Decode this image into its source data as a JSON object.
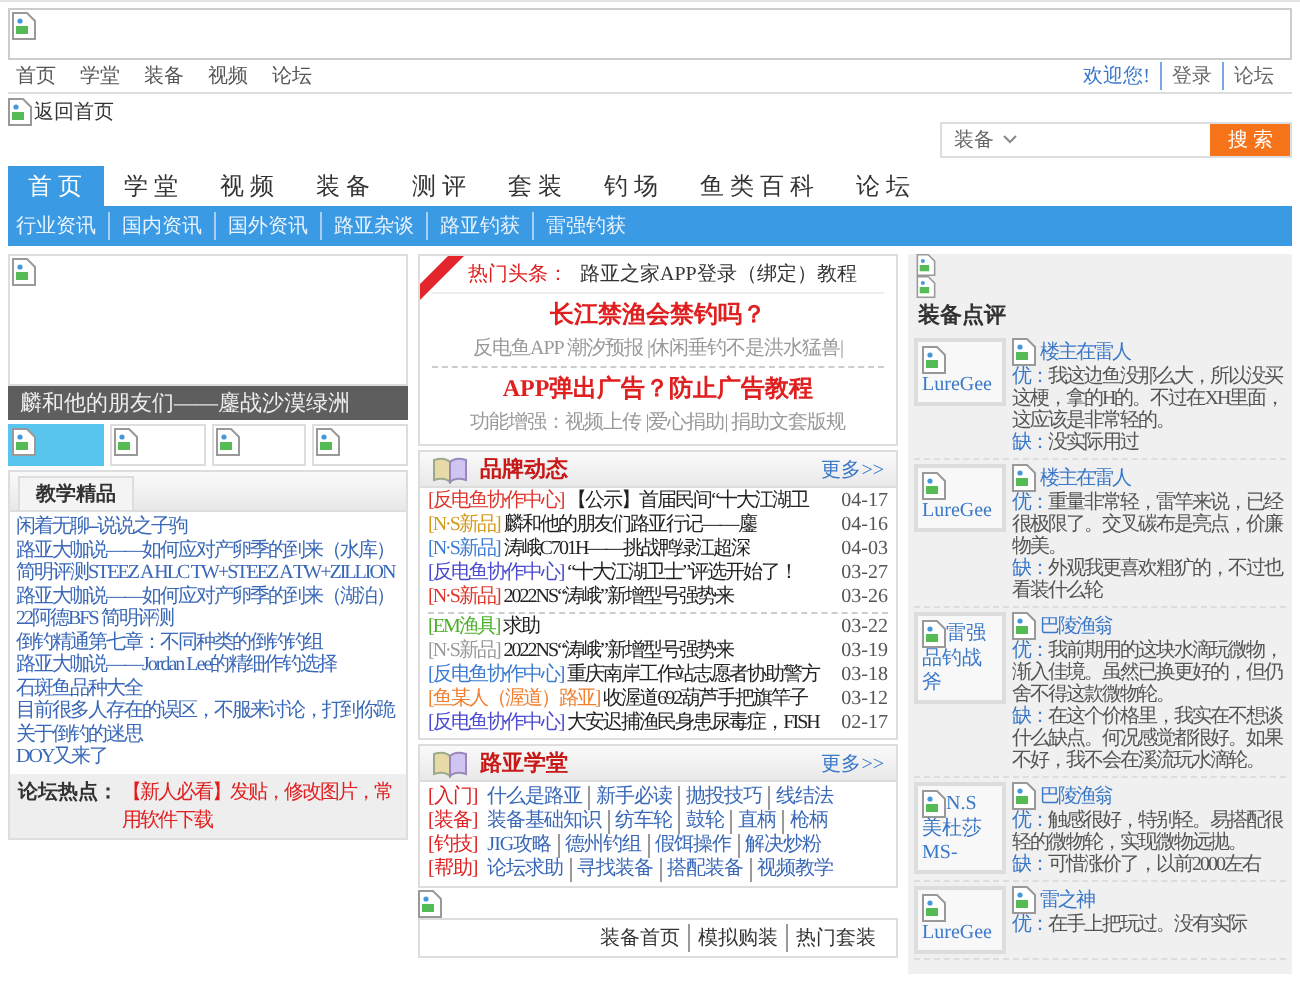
{
  "top_links": [
    "首页",
    "学堂",
    "装备",
    "视频",
    "论坛"
  ],
  "user_links": [
    {
      "label": "欢迎您!",
      "kind": "greeting"
    },
    {
      "label": "登录",
      "kind": "link"
    },
    {
      "label": "论坛",
      "kind": "link"
    }
  ],
  "home_logo_alt": "返回首页",
  "search": {
    "category": "装备",
    "button": "搜 索"
  },
  "nav": [
    {
      "label": "首页",
      "selected": true
    },
    {
      "label": "学堂",
      "selected": false
    },
    {
      "label": "视频",
      "selected": false
    },
    {
      "label": "装备",
      "selected": false
    },
    {
      "label": "测评",
      "selected": false
    },
    {
      "label": "套装",
      "selected": false
    },
    {
      "label": "钓场",
      "selected": false
    },
    {
      "label": "鱼类百科",
      "selected": false
    },
    {
      "label": "论坛",
      "selected": false
    }
  ],
  "subnav": [
    "行业资讯",
    "国内资讯",
    "国外资讯",
    "路亚杂谈",
    "路亚钓获",
    "雷强钓获"
  ],
  "slideshow": {
    "caption": "麟和他的朋友们——鏖战沙漠绿洲",
    "thumbnails": [
      {
        "selected": true
      },
      {
        "selected": false
      },
      {
        "selected": false
      },
      {
        "selected": false
      }
    ]
  },
  "tutorials": {
    "tab": "教学精品",
    "items": [
      "闲着无聊--说说之子驹",
      "路亚大咖说——如何应对产卵季的到来（水库）",
      "简明评测STEEZ A HLC TW+STEEZ A TW+ZILLION",
      "路亚大咖说——如何应对产卵季的到来（湖泊）",
      "22阿德BFS 简明评测",
      "倒钓精通第七章：不同种类的倒钓钓组",
      "路亚大咖说——Jordan Lee的精细作钓选择",
      "石斑鱼品种大全",
      "目前很多人存在的误区，不服来讨论，打到你跪",
      "关于倒钓的迷思",
      "DOY又来了"
    ]
  },
  "forum_hot": {
    "label": "论坛热点：",
    "text": "【新人必看】发贴，修改图片，常用软件下载"
  },
  "headlines": {
    "hot_label": "热门头条：",
    "hot_title": "路亚之家APP登录（绑定）教程",
    "stories": [
      {
        "title": "长江禁渔会禁钓吗？",
        "sub": "反电鱼APP 潮汐预报 |休闲垂钓不是洪水猛兽|"
      },
      {
        "title": "APP弹出广告？防止广告教程",
        "sub": "功能增强：视频上传 |爱心捐助| 捐助文套版规"
      }
    ]
  },
  "brand_news": {
    "title": "品牌动态",
    "more": "更多>>",
    "groups": [
      [
        {
          "tag": "[反电鱼协作中心]",
          "color": "#e0352b",
          "title": "【公示】首届民间“十大江湖卫",
          "date": "04-17"
        },
        {
          "tag": "[N·S新品]",
          "color": "#d49a1c",
          "title": "麟和他的朋友们路亚行记——鏖",
          "date": "04-16"
        },
        {
          "tag": "[N·S新品]",
          "color": "#3b7bd1",
          "title": "涛峨C701H——挑战鸭绿江超深",
          "date": "04-03"
        },
        {
          "tag": "[反电鱼协作中心]",
          "color": "#4a4ad0",
          "title": "“十大江湖卫士”评选开始了！",
          "date": "03-27"
        },
        {
          "tag": "[N·S新品]",
          "color": "#e0352b",
          "title": "2022NS“涛峨”新增型号强势来",
          "date": "03-26"
        }
      ],
      [
        {
          "tag": "[EM渔具]",
          "color": "#4caf2a",
          "title": "求助",
          "date": "03-22"
        },
        {
          "tag": "[N·S新品]",
          "color": "#999999",
          "title": "2022NS“涛峨”新增型号强势来",
          "date": "03-19"
        },
        {
          "tag": "[反电鱼协作中心]",
          "color": "#3b7bd1",
          "title": "重庆南岸工作站志愿者协助警方",
          "date": "03-18"
        },
        {
          "tag": "[鱼某人（渥道）路亚]",
          "color": "#f08030",
          "title": "收渥道692葫芦手把旗竿子",
          "date": "03-12"
        },
        {
          "tag": "[反电鱼协作中心]",
          "color": "#4a4ad0",
          "title": "大安迟捕渔民身患尿毒症，FISH",
          "date": "02-17"
        }
      ]
    ]
  },
  "lure_school": {
    "title": "路亚学堂",
    "more": "更多>>",
    "lines": [
      {
        "tag": "[入门]",
        "links": [
          "什么是路亚",
          "新手必读",
          "抛投技巧",
          "线结法"
        ]
      },
      {
        "tag": "[装备]",
        "links": [
          "装备基础知识",
          "纺车轮",
          "鼓轮",
          "直柄",
          "枪柄"
        ]
      },
      {
        "tag": "[钓技]",
        "links": [
          "JIG攻略",
          "德州钓组",
          "假饵操作",
          "解决炒粉"
        ]
      },
      {
        "tag": "[帮助]",
        "links": [
          "论坛求助",
          "寻找装备",
          "搭配装备",
          "视频教学"
        ]
      }
    ]
  },
  "equipment_links": [
    "装备首页",
    "模拟购装",
    "热门套装"
  ],
  "reviews": {
    "title": "装备点评",
    "items": [
      {
        "avatar_alt": "LureGee",
        "user": "楼主在雷人",
        "pro_label": "优：",
        "pro": "我这边鱼没那么大，所以没买这梗，拿的H的。不过在XH里面，这应该是非常轻的。",
        "con_label": "缺：",
        "con": "没实际用过"
      },
      {
        "avatar_alt": "LureGee",
        "user": "楼主在雷人",
        "pro_label": "优：",
        "pro": "重量非常轻，雷竿来说，已经很极限了。交叉碳布是亮点，价廉物美。",
        "con_label": "缺：",
        "con": "外观我更喜欢粗犷的，不过也看装什么轮"
      },
      {
        "avatar_alt": "雷强品钓战斧",
        "user": "巴陵渔翁",
        "pro_label": "优：",
        "pro": "我前期用的这块水滴玩微物，渐入佳境。虽然已换更好的，但仍舍不得这款微物轮。",
        "con_label": "缺：",
        "con": "在这个价格里，我实在不想谈什么缺点。何况感觉都很好。如果不好，我不会在溪流玩水滴轮。"
      },
      {
        "avatar_alt": "N.S 美杜莎 MS-",
        "user": "巴陵渔翁",
        "pro_label": "优：",
        "pro": "触感很好，特别轻。易搭配很轻的微物轮，实现微物远抛。",
        "con_label": "缺：",
        "con": "可惜涨价了，以前2000左右"
      },
      {
        "avatar_alt": "LureGee",
        "user": "雷之神",
        "pro_label": "优：",
        "pro": "在手上把玩过。没有实际"
      }
    ]
  }
}
